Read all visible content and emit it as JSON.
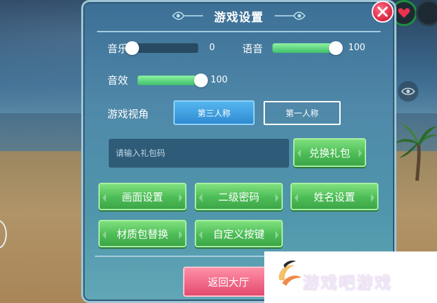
{
  "panel": {
    "title": "游戏设置"
  },
  "audio": {
    "music_label": "音乐",
    "music_value": "0",
    "music_level": 0,
    "voice_label": "语音",
    "voice_value": "100",
    "voice_level": 1,
    "sfx_label": "音效",
    "sfx_value": "100",
    "sfx_level": 1
  },
  "camera": {
    "label": "游戏视角",
    "third_person": "第三人称",
    "first_person": "第一人称",
    "selected": "第三人称"
  },
  "gift": {
    "placeholder": "请输入礼包码",
    "redeem_label": "兑换礼包"
  },
  "menu": {
    "graphics_settings": "画面设置",
    "secondary_password": "二级密码",
    "name_settings": "姓名设置",
    "texture_pack": "材质包替换",
    "custom_keys": "自定义按键"
  },
  "footer": {
    "return_lobby": "返回大厅"
  },
  "watermark": {
    "text": "游戏吧游戏"
  },
  "colors": {
    "panel_top": "#3c6f95",
    "panel_bottom": "#62a7b7",
    "slider_fill": "#3fbf6a",
    "primary_button": "#4cbc56",
    "selected_tab": "#2f8bd2",
    "danger_button": "#e24a6e",
    "close_button": "#d8243f"
  }
}
